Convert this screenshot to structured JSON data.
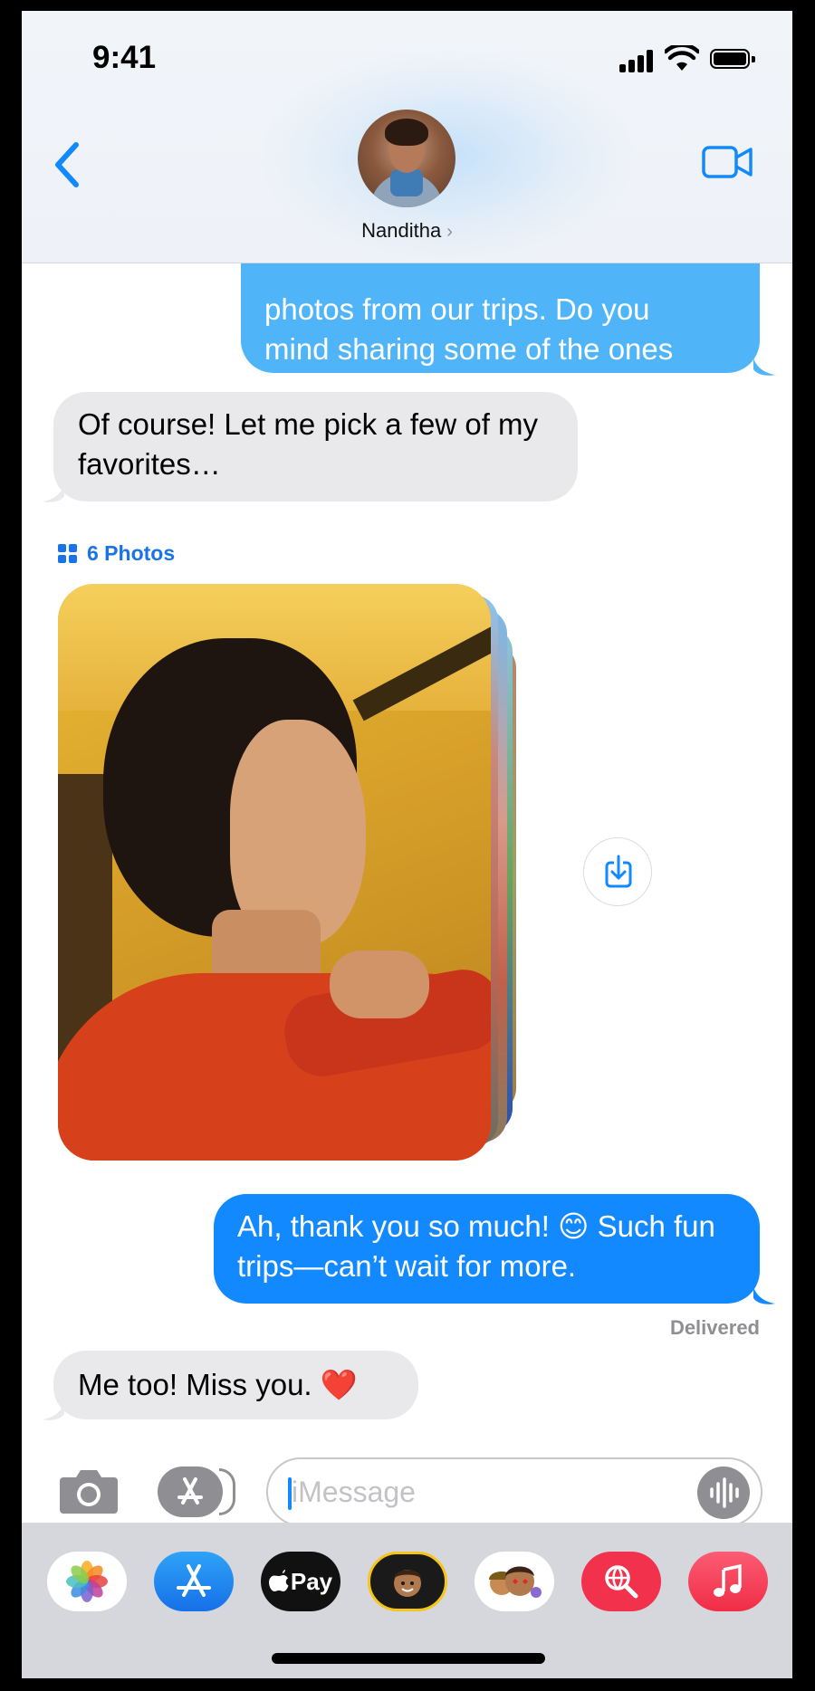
{
  "status_bar": {
    "time": "9:41"
  },
  "header": {
    "contact_name": "Nanditha",
    "chevron": "›"
  },
  "messages": {
    "partial_top": "photos from our trips. Do you\nmind sharing some of the ones\nyou took?",
    "reply_1": "Of course! Let me pick a few of my favorites…",
    "photos_label": "6 Photos",
    "sent_2": "Ah, thank you so much! 😊 Such fun trips—can’t wait for more.",
    "delivered": "Delivered",
    "reply_2": "Me too! Miss you. ❤️"
  },
  "compose": {
    "placeholder": "iMessage"
  },
  "drawer": {
    "apps": [
      "photos-app",
      "app-store-app",
      "apple-pay-app",
      "memoji-app",
      "memoji-stickers-app",
      "images-search-app",
      "music-app"
    ],
    "apple_pay_label": "Pay"
  },
  "colors": {
    "sent": "#1289fe",
    "received": "#e9e9eb",
    "accent": "#1a73e8"
  }
}
